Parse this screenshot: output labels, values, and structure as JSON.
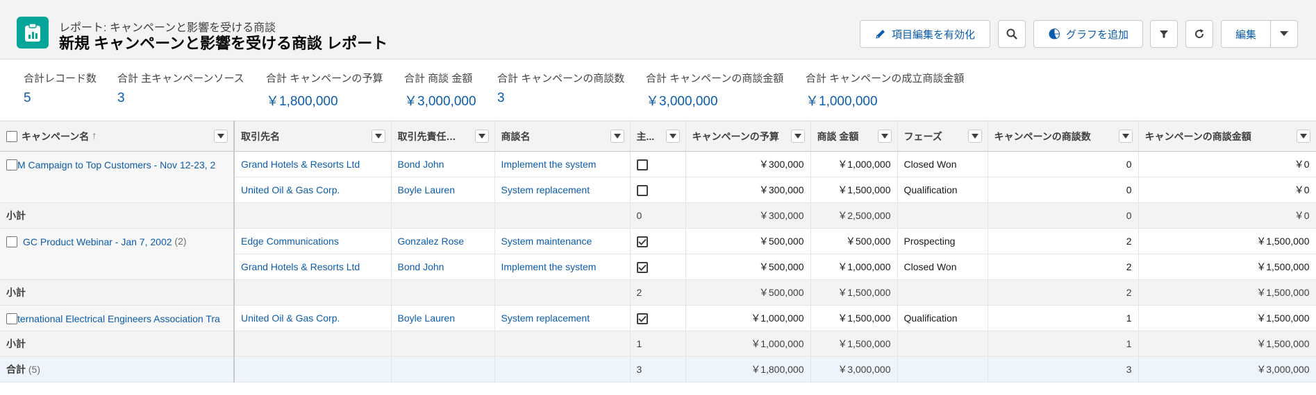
{
  "header": {
    "subtitle": "レポート: キャンペーンと影響を受ける商談",
    "title": "新規 キャンペーンと影響を受ける商談 レポート",
    "buttons": {
      "inline_edit": "項目編集を有効化",
      "add_chart": "グラフを追加",
      "edit": "編集"
    }
  },
  "summary": [
    {
      "label": "合計レコード数",
      "value": "5"
    },
    {
      "label": "合計 主キャンペーンソース",
      "value": "3"
    },
    {
      "label": "合計 キャンペーンの予算",
      "value": "￥1,800,000"
    },
    {
      "label": "合計 商談 金額",
      "value": "￥3,000,000"
    },
    {
      "label": "合計 キャンペーンの商談数",
      "value": "3"
    },
    {
      "label": "合計 キャンペーンの商談金額",
      "value": "￥3,000,000"
    },
    {
      "label": "合計 キャンペーンの成立商談金額",
      "value": "￥1,000,000"
    }
  ],
  "columns": [
    "キャンペーン名",
    "取引先名",
    "取引先責任者名",
    "商談名",
    "主...",
    "キャンペーンの予算",
    "商談 金額",
    "フェーズ",
    "キャンペーンの商談数",
    "キャンペーンの商談金額"
  ],
  "sort_arrow": "↑",
  "groups": [
    {
      "name": "M Campaign to Top Customers - Nov 12-23, 2",
      "count": "",
      "rows": [
        {
          "account": "Grand Hotels & Resorts Ltd",
          "contact": "Bond John",
          "opp": "Implement the system",
          "primary": false,
          "budget": "￥300,000",
          "amount": "￥1,000,000",
          "phase": "Closed Won",
          "opp_count": "0",
          "opp_amount": "￥0"
        },
        {
          "account": "United Oil & Gas Corp.",
          "contact": "Boyle Lauren",
          "opp": "System replacement",
          "primary": false,
          "budget": "￥300,000",
          "amount": "￥1,500,000",
          "phase": "Qualification",
          "opp_count": "0",
          "opp_amount": "￥0"
        }
      ],
      "subtotal": {
        "label": "小計",
        "primary": "0",
        "budget": "￥300,000",
        "amount": "￥2,500,000",
        "opp_count": "0",
        "opp_amount": "￥0"
      }
    },
    {
      "name": "GC Product Webinar - Jan 7, 2002",
      "count": "(2)",
      "rows": [
        {
          "account": "Edge Communications",
          "contact": "Gonzalez Rose",
          "opp": "System maintenance",
          "primary": true,
          "budget": "￥500,000",
          "amount": "￥500,000",
          "phase": "Prospecting",
          "opp_count": "2",
          "opp_amount": "￥1,500,000"
        },
        {
          "account": "Grand Hotels & Resorts Ltd",
          "contact": "Bond John",
          "opp": "Implement the system",
          "primary": true,
          "budget": "￥500,000",
          "amount": "￥1,000,000",
          "phase": "Closed Won",
          "opp_count": "2",
          "opp_amount": "￥1,500,000"
        }
      ],
      "subtotal": {
        "label": "小計",
        "primary": "2",
        "budget": "￥500,000",
        "amount": "￥1,500,000",
        "opp_count": "2",
        "opp_amount": "￥1,500,000"
      }
    },
    {
      "name": "ternational Electrical Engineers Association Tra",
      "count": "",
      "rows": [
        {
          "account": "United Oil & Gas Corp.",
          "contact": "Boyle Lauren",
          "opp": "System replacement",
          "primary": true,
          "budget": "￥1,000,000",
          "amount": "￥1,500,000",
          "phase": "Qualification",
          "opp_count": "1",
          "opp_amount": "￥1,500,000"
        }
      ],
      "subtotal": {
        "label": "小計",
        "primary": "1",
        "budget": "￥1,000,000",
        "amount": "￥1,500,000",
        "opp_count": "1",
        "opp_amount": "￥1,500,000"
      }
    }
  ],
  "grand_total": {
    "label": "合計",
    "count": "(5)",
    "primary": "3",
    "budget": "￥1,800,000",
    "amount": "￥3,000,000",
    "opp_count": "3",
    "opp_amount": "￥3,000,000"
  },
  "icons": [
    "report-icon",
    "pencil-icon",
    "search-icon",
    "chart-icon",
    "filter-icon",
    "refresh-icon",
    "chevron-down-icon"
  ],
  "colors": {
    "brand": "#06a59a",
    "link": "#0b5cab"
  }
}
